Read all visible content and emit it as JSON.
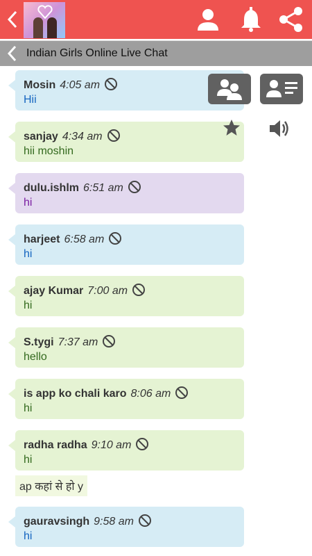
{
  "header": {
    "title": "Indian Girls Online Live Chat",
    "icons": [
      "back-arrow-icon",
      "profile-icon",
      "bell-icon",
      "share-icon"
    ]
  },
  "messages": [
    {
      "user": "Mosin",
      "time": "4:05 am",
      "text": "Hii",
      "color": "blue"
    },
    {
      "user": "sanjay",
      "time": "4:34 am",
      "text": "hii moshin",
      "color": "green"
    },
    {
      "user": "dulu.ishlm",
      "time": "6:51 am",
      "text": "hi",
      "color": "purple"
    },
    {
      "user": "harjeet",
      "time": "6:58 am",
      "text": "hi",
      "color": "blue"
    },
    {
      "user": "ajay Kumar",
      "time": "7:00 am",
      "text": "hi",
      "color": "green"
    },
    {
      "user": "S.tygi",
      "time": "7:37 am",
      "text": "hello",
      "color": "green"
    },
    {
      "user": "is app ko chali karo",
      "time": "8:06 am",
      "text": "hi",
      "color": "green"
    },
    {
      "user": "radha radha",
      "time": "9:10 am",
      "text": "hi",
      "color": "green"
    },
    {
      "user": "gauravsingh",
      "time": "9:58 am",
      "text": "hi",
      "color": "blue"
    }
  ],
  "plain_message": "ap कहां से हो y",
  "colors": {
    "topbar": "#ef5350",
    "subbar": "#9e9e9e",
    "button": "#616161"
  }
}
